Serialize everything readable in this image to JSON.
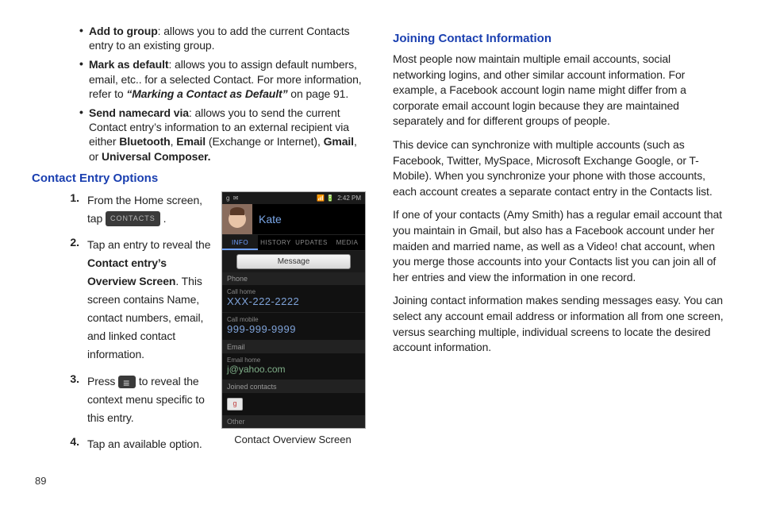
{
  "left": {
    "bullets": [
      {
        "lead": "Add to group",
        "rest": ": allows you to add the current Contacts entry to an existing group."
      },
      {
        "lead": "Mark as default",
        "rest_a": ": allows you to assign default numbers, email, etc.. for a selected Contact. For more information, refer to ",
        "link": "“Marking a Contact as Default”",
        "rest_b": "  on page 91."
      },
      {
        "lead": "Send namecard via",
        "rest_a": ": allows you to send the current Contact entry’s information to an external recipient via either ",
        "b1": "Bluetooth",
        "rest_b": ", ",
        "b2": "Email",
        "rest_c": " (Exchange or Internet), ",
        "b3": "Gmail",
        "rest_d": ", or ",
        "b4": "Universal Composer."
      }
    ],
    "heading": "Contact Entry Options",
    "steps": {
      "s1a": "From the Home screen, tap ",
      "pill": "CONTACTS",
      "s1b": " .",
      "s2a": "Tap an entry to reveal the ",
      "s2b": "Contact entry’s Overview Screen",
      "s2c": ". This screen contains Name, contact numbers, email, and linked contact information.",
      "s3a": "Press ",
      "s3b": " to reveal the context menu specific to this entry.",
      "s4": "Tap an available option."
    },
    "phone": {
      "time": "2:42 PM",
      "name": "Kate",
      "tabs": [
        "INFO",
        "HISTORY",
        "UPDATES",
        "MEDIA"
      ],
      "message_btn": "Message",
      "sec_phone": "Phone",
      "f1_label": "Call home",
      "f1_value": "XXX-222-2222",
      "f2_label": "Call mobile",
      "f2_value": "999-999-9999",
      "sec_email": "Email",
      "f3_label": "Email home",
      "f3_value": "j@yahoo.com",
      "sec_joined": "Joined contacts",
      "google_g": "g",
      "sec_other": "Other",
      "caption": "Contact Overview Screen"
    }
  },
  "right": {
    "heading": "Joining Contact Information",
    "p1": "Most people now maintain multiple email accounts, social networking logins, and other similar account information. For example, a Facebook account login name might differ from a corporate email account login because they are maintained separately and for different groups of people.",
    "p2": "This device can synchronize with multiple accounts (such as Facebook, Twitter, MySpace, Microsoft Exchange Google, or T-Mobile). When you synchronize your phone with those accounts, each account creates a separate contact entry in the Contacts list.",
    "p3": "If one of your contacts (Amy Smith) has a regular email account that you maintain in Gmail, but also has a Facebook account under her maiden and married name, as well as a Video! chat account, when you merge those accounts into your Contacts list you can join all of her entries and view the information in one record.",
    "p4": "Joining contact information makes sending messages easy. You can select any account email address or information all from one screen, versus searching multiple, individual screens to locate the desired account information."
  },
  "page_number": "89"
}
